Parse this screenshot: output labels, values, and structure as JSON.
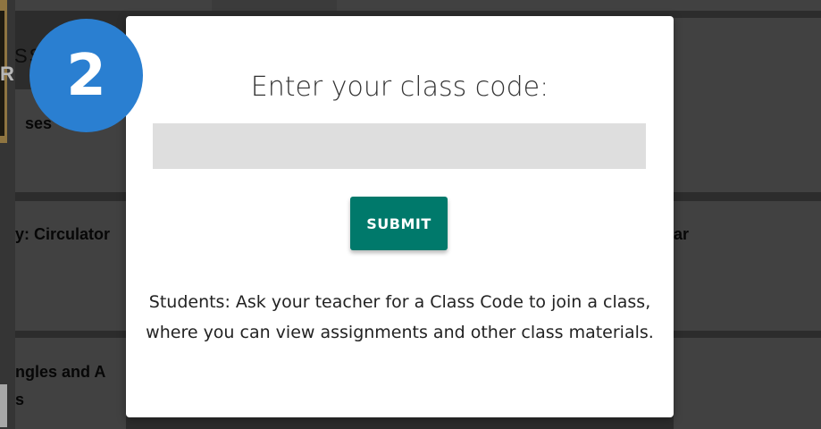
{
  "background": {
    "card_titles": [
      "ses",
      "y: Circulator",
      "ar",
      "ngles and A",
      "s"
    ],
    "partial_header": "SS",
    "partial_letter": "R"
  },
  "step_badge": {
    "number": "2",
    "color": "#2a7fd1"
  },
  "modal": {
    "title": "Enter your class code:",
    "input": {
      "value": "",
      "placeholder": ""
    },
    "submit_label": "SUBMIT",
    "help_text": "Students: Ask your teacher for a Class Code to join a class, where you can view assignments and other class materials.",
    "accent_color": "#00796b"
  }
}
